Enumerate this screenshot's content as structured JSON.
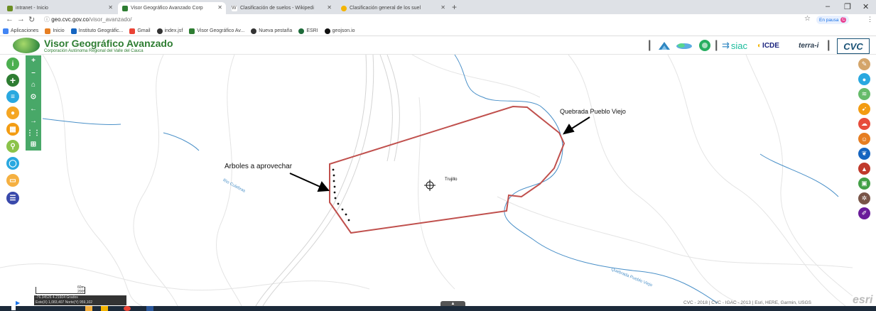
{
  "browser": {
    "tabs": [
      {
        "title": "intranet - Inicio",
        "icon_color": "#6b8e23",
        "active": false
      },
      {
        "title": "Visor Geográfico Avanzado Corp",
        "icon_color": "#2e7d32",
        "active": true
      },
      {
        "title": "Clasificación de suelos - Wikipedi",
        "icon_color": "#555555",
        "active": false
      },
      {
        "title": "Clasificación general de los suel",
        "icon_color": "#f4b400",
        "active": false
      }
    ],
    "new_tab": "+",
    "window_controls": [
      "–",
      "❐",
      "✕"
    ],
    "url_host": "geo.cvc.gov.co",
    "url_path": "/visor_avanzado/",
    "pause_label": "En pausa",
    "profile_initial": "C",
    "bookmarks": [
      {
        "label": "Aplicaciones",
        "icon_color": "#4285f4"
      },
      {
        "label": "Inicio",
        "icon_color": "#e67e22"
      },
      {
        "label": "Instituto Geográfic...",
        "icon_color": "#1565c0"
      },
      {
        "label": "Gmail",
        "icon_color": "#ea4335"
      },
      {
        "label": "index.jsf",
        "icon_color": "#333333"
      },
      {
        "label": "Visor Geográfico Av...",
        "icon_color": "#2e7d32"
      },
      {
        "label": "Nueva pestaña",
        "icon_color": "#333333"
      },
      {
        "label": "ESRI",
        "icon_color": "#1e6b3a"
      },
      {
        "label": "geojson.io",
        "icon_color": "#111111"
      }
    ]
  },
  "app": {
    "title": "Visor Geográfico Avanzado",
    "subtitle": "Corporación Autónoma Regional del Valle del Cauca",
    "header_logos": {
      "siac": "siac",
      "icde": "ICDE",
      "terra": "terra-i",
      "cvc": "CVC"
    },
    "accent": "#2e7d32",
    "polygon_color": "#c0504d",
    "river_color": "#4a90c8"
  },
  "left_tools": [
    {
      "icon": "info-icon",
      "color": "#4caf50",
      "glyph": "ⓘ"
    },
    {
      "icon": "add-icon",
      "color": "#4caf50",
      "glyph": "+"
    },
    {
      "icon": "layers-icon",
      "color": "#29a8e0",
      "glyph": "≡"
    },
    {
      "icon": "location-icon",
      "color": "#f5a623",
      "glyph": "⚲"
    },
    {
      "icon": "table-icon",
      "color": "#f39c12",
      "glyph": "▦"
    },
    {
      "icon": "search-icon",
      "color": "#8bc34a",
      "glyph": "⚲"
    },
    {
      "icon": "basemap-icon",
      "color": "#29a8e0",
      "glyph": "◯"
    },
    {
      "icon": "folder-icon",
      "color": "#f5b041",
      "glyph": "▭"
    },
    {
      "icon": "menu-icon",
      "color": "#3949ab",
      "glyph": "☰"
    }
  ],
  "nav_tools": [
    {
      "icon": "zoom-in-icon",
      "glyph": "+"
    },
    {
      "icon": "zoom-out-icon",
      "glyph": "–"
    },
    {
      "icon": "home-icon",
      "glyph": "⌂"
    },
    {
      "icon": "locate-icon",
      "glyph": "⊙"
    },
    {
      "icon": "back-icon",
      "glyph": "←"
    },
    {
      "icon": "forward-icon",
      "glyph": "→"
    },
    {
      "icon": "fullscreen-icon",
      "glyph": "⛶"
    },
    {
      "icon": "extent-icon",
      "glyph": "⊞"
    }
  ],
  "right_tools": [
    {
      "icon": "soil-icon",
      "color": "#d4a56a",
      "glyph": "✎"
    },
    {
      "icon": "water-icon",
      "color": "#29a8e0",
      "glyph": "💧"
    },
    {
      "icon": "climate-icon",
      "color": "#66bb6a",
      "glyph": "≋"
    },
    {
      "icon": "fauna-icon",
      "color": "#f39c12",
      "glyph": "✈"
    },
    {
      "icon": "risk-icon",
      "color": "#e74c3c",
      "glyph": "☁"
    },
    {
      "icon": "population-icon",
      "color": "#e67e22",
      "glyph": "☺"
    },
    {
      "icon": "biodiversity-icon",
      "color": "#1565c0",
      "glyph": "❦"
    },
    {
      "icon": "terrain-icon",
      "color": "#c0392b",
      "glyph": "▲"
    },
    {
      "icon": "image-icon",
      "color": "#43a047",
      "glyph": "▣"
    },
    {
      "icon": "hazard-icon",
      "color": "#795548",
      "glyph": "✲"
    },
    {
      "icon": "tools-icon",
      "color": "#6a1b9a",
      "glyph": "✐"
    }
  ],
  "map": {
    "label_arboles": "Arboles a aprovechar",
    "label_quebrada": "Quebrada Pueblo Viejo",
    "label_town": "Trujillo",
    "river_1": "Rio Culebras",
    "river_2": "Quebrada Pueblo Viejo",
    "scale_label": "60m",
    "scale_sub": "200ft",
    "coords_line1": "-76.34526 4.21604 Grados",
    "coords_line2": "Este(X) 1,083,407 Norte(Y) 959,102",
    "attribution": "CVC - 2018 | CVC - IGAC - 2013 | Esri, HERE, Garmin, USGS",
    "esri_watermark": "esri",
    "handle_label": "▲"
  }
}
